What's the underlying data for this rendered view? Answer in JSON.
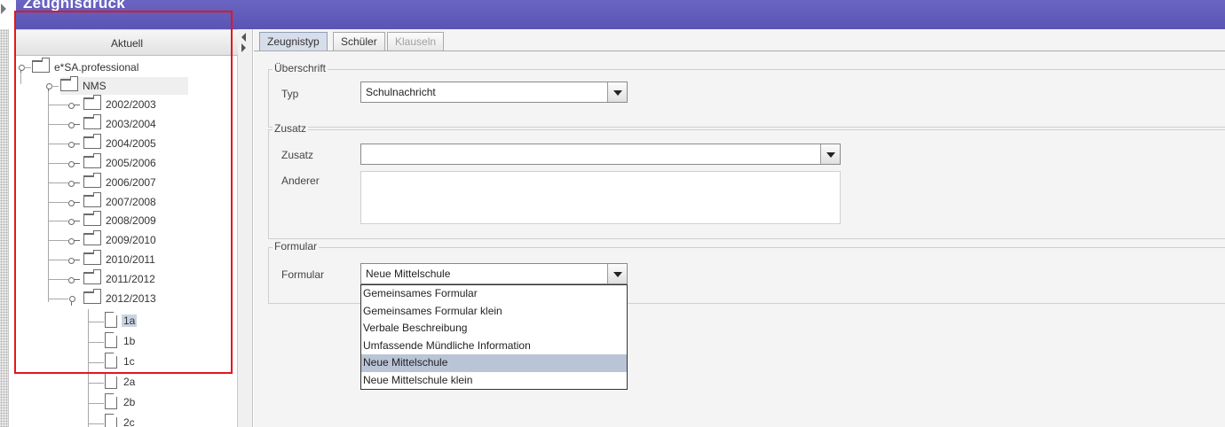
{
  "window": {
    "title": "Zeugnisdruck"
  },
  "tree": {
    "header": "Aktuell",
    "root": "e*SA.professional",
    "school": "NMS",
    "years": [
      "2002/2003",
      "2003/2004",
      "2004/2005",
      "2005/2006",
      "2006/2007",
      "2007/2008",
      "2008/2009",
      "2009/2010",
      "2010/2011",
      "2011/2012",
      "2012/2013"
    ],
    "classes": [
      "1a",
      "1b",
      "1c",
      "2a",
      "2b",
      "2c"
    ],
    "selected_class": "1a"
  },
  "tabs": [
    {
      "label": "Zeugnistyp",
      "state": "active"
    },
    {
      "label": "Schüler",
      "state": "normal"
    },
    {
      "label": "Klauseln",
      "state": "disabled"
    }
  ],
  "sections": {
    "ueberschrift": {
      "title": "Überschrift",
      "typ_label": "Typ",
      "typ_value": "Schulnachricht"
    },
    "zusatz": {
      "title": "Zusatz",
      "zusatz_label": "Zusatz",
      "zusatz_value": "",
      "anderer_label": "Anderer"
    },
    "formular": {
      "title": "Formular",
      "formular_label": "Formular",
      "formular_value": "Neue Mittelschule",
      "options": [
        "Gemeinsames Formular",
        "Gemeinsames Formular klein",
        "Verbale Beschreibung",
        "Umfassende Mündliche Information",
        "Neue Mittelschule",
        "Neue Mittelschule klein"
      ],
      "selected_option": "Neue Mittelschule"
    }
  },
  "colors": {
    "titlebar": "#5a54b4",
    "selection": "#b9c4d6",
    "annotation": "#e4171b"
  }
}
